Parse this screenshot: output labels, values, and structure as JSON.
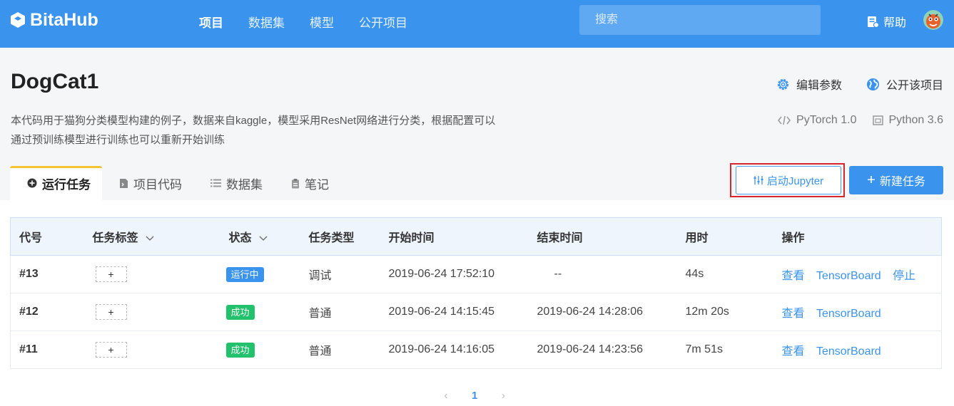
{
  "header": {
    "logo_text": "BitaHub",
    "nav": [
      {
        "label": "项目",
        "active": true
      },
      {
        "label": "数据集",
        "active": false
      },
      {
        "label": "模型",
        "active": false
      },
      {
        "label": "公开项目",
        "active": false
      }
    ],
    "search_placeholder": "搜索",
    "help_label": "帮助",
    "brand_color": "#3a94ee"
  },
  "project": {
    "title": "DogCat1",
    "description": "本代码用于猫狗分类模型构建的例子，数据来自kaggle，模型采用ResNet网络进行分类，根据配置可以通过预训练模型进行训练也可以重新开始训练",
    "actions": {
      "edit_params": "编辑参数",
      "make_public": "公开该项目"
    },
    "meta": {
      "framework": "PyTorch 1.0",
      "language": "Python 3.6"
    }
  },
  "tabs": [
    {
      "label": "运行任务",
      "icon": "plus-circle-icon",
      "active": true
    },
    {
      "label": "项目代码",
      "icon": "code-file-icon",
      "active": false
    },
    {
      "label": "数据集",
      "icon": "list-icon",
      "active": false
    },
    {
      "label": "笔记",
      "icon": "clipboard-icon",
      "active": false
    }
  ],
  "buttons": {
    "jupyter": "启动Jupyter",
    "new_task": "新建任务"
  },
  "table": {
    "columns": [
      "代号",
      "任务标签",
      "状态",
      "任务类型",
      "开始时间",
      "结束时间",
      "用时",
      "操作"
    ],
    "tag_add": "+",
    "rows": [
      {
        "id": "#13",
        "status": "运行中",
        "status_kind": "running",
        "type": "调试",
        "start": "2019-06-24 17:52:10",
        "end": "--",
        "duration": "44s",
        "actions": [
          "查看",
          "TensorBoard",
          "停止"
        ]
      },
      {
        "id": "#12",
        "status": "成功",
        "status_kind": "success",
        "type": "普通",
        "start": "2019-06-24 14:15:45",
        "end": "2019-06-24 14:28:06",
        "duration": "12m 20s",
        "actions": [
          "查看",
          "TensorBoard"
        ]
      },
      {
        "id": "#11",
        "status": "成功",
        "status_kind": "success",
        "type": "普通",
        "start": "2019-06-24 14:16:05",
        "end": "2019-06-24 14:23:56",
        "duration": "7m 51s",
        "actions": [
          "查看",
          "TensorBoard"
        ]
      }
    ]
  },
  "pagination": {
    "current": "1",
    "prev": "‹",
    "next": "›"
  }
}
